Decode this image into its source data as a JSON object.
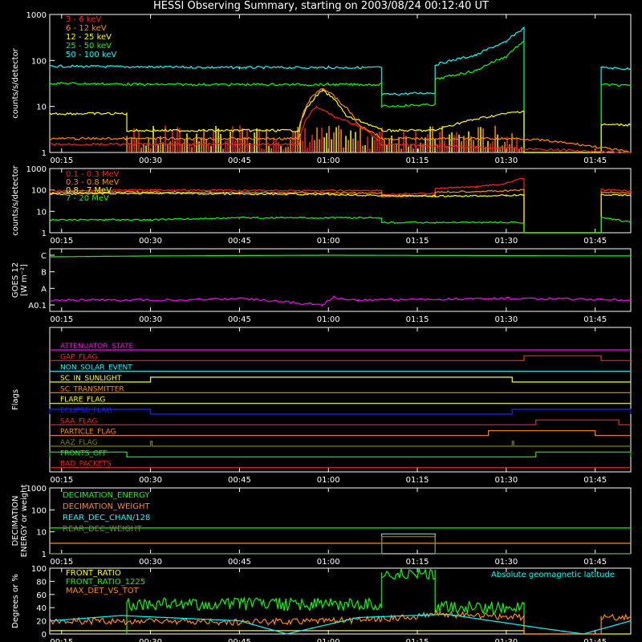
{
  "title": "HESSI Observing Summary, starting on 2003/08/24 00:12:40 UT",
  "x_ticks": [
    "00:15",
    "00:30",
    "00:45",
    "01:00",
    "01:15",
    "01:30",
    "01:45"
  ],
  "chart_data": [
    {
      "type": "line",
      "panel": "low_energy_rates",
      "ylabel": "counts/s/detector",
      "ylog": true,
      "ylim": [
        1,
        1000
      ],
      "y_ticks": [
        "1",
        "10",
        "100",
        "1000"
      ],
      "legend": [
        "3 - 6 keV",
        "6 - 12 keV",
        "12 - 25 keV",
        "25 - 50 keV",
        "50 - 100 keV"
      ],
      "legend_placement": "top-left",
      "colors": [
        "#ff2020",
        "#ff8c00",
        "#ffff00",
        "#00ff00",
        "#00ffff"
      ],
      "series": [
        {
          "name": "50 - 100 keV",
          "x": [
            "00:13",
            "00:30",
            "00:45",
            "01:00",
            "01:09",
            "01:09",
            "01:18",
            "01:18",
            "01:25",
            "01:30",
            "01:33",
            "01:33",
            "01:46",
            "01:46",
            "01:51"
          ],
          "y": [
            75,
            72,
            70,
            70,
            70,
            18,
            20,
            80,
            130,
            250,
            500,
            1,
            1,
            70,
            65
          ]
        },
        {
          "name": "25 - 50 keV",
          "x": [
            "00:13",
            "00:30",
            "00:45",
            "01:00",
            "01:09",
            "01:09",
            "01:18",
            "01:18",
            "01:25",
            "01:30",
            "01:33",
            "01:33",
            "01:46",
            "01:46",
            "01:51"
          ],
          "y": [
            32,
            30,
            30,
            30,
            30,
            10,
            11,
            38,
            60,
            120,
            250,
            1,
            1,
            30,
            28
          ]
        },
        {
          "name": "12 - 25 keV",
          "x": [
            "00:13",
            "00:26",
            "00:26",
            "00:55",
            "00:57",
            "00:59",
            "01:03",
            "01:09",
            "01:18",
            "01:33",
            "01:33",
            "01:46",
            "01:46",
            "01:51"
          ],
          "y": [
            7,
            7,
            3,
            3,
            12,
            22,
            6,
            3,
            3,
            8,
            1,
            1,
            4,
            4
          ]
        },
        {
          "name": "6 - 12 keV",
          "x": [
            "00:13",
            "00:26",
            "00:55",
            "00:57",
            "00:59",
            "01:02",
            "01:05",
            "01:09",
            "01:33",
            "01:51"
          ],
          "y": [
            2,
            2,
            2,
            15,
            25,
            12,
            4,
            2,
            2,
            1
          ]
        },
        {
          "name": "3 - 6 keV",
          "x": [
            "00:13",
            "00:55",
            "00:58",
            "01:01",
            "01:09",
            "01:33",
            "01:51"
          ],
          "y": [
            1.5,
            1.5,
            10,
            6,
            1.5,
            1.2,
            1
          ]
        }
      ]
    },
    {
      "type": "line",
      "panel": "high_energy_rates",
      "ylabel": "counts/s/detector",
      "ylog": true,
      "ylim": [
        1,
        1000
      ],
      "y_ticks": [
        "1",
        "10",
        "100",
        "1000"
      ],
      "legend": [
        "0.1 - 0.3 MeV",
        "0.3 - 0.8 MeV",
        "0.8 - 7 MeV",
        "7 - 20 MeV"
      ],
      "legend_placement": "top-left",
      "colors": [
        "#ff2020",
        "#ff8c00",
        "#ffff00",
        "#00ff00"
      ],
      "series": [
        {
          "name": "0.1 - 0.3 MeV",
          "x": [
            "00:13",
            "00:30",
            "00:45",
            "01:00",
            "01:09",
            "01:09",
            "01:18",
            "01:18",
            "01:25",
            "01:30",
            "01:33",
            "01:33",
            "01:46",
            "01:46",
            "01:51"
          ],
          "y": [
            90,
            100,
            95,
            92,
            95,
            60,
            70,
            120,
            140,
            200,
            350,
            1,
            1,
            100,
            90
          ]
        },
        {
          "name": "0.3 - 0.8 MeV",
          "x": [
            "00:13",
            "00:30",
            "00:45",
            "01:00",
            "01:09",
            "01:09",
            "01:18",
            "01:18",
            "01:30",
            "01:33",
            "01:33",
            "01:46",
            "01:46",
            "01:51"
          ],
          "y": [
            75,
            80,
            75,
            72,
            72,
            50,
            55,
            80,
            90,
            100,
            1,
            1,
            80,
            70
          ]
        },
        {
          "name": "0.8 - 7 MeV",
          "x": [
            "00:13",
            "00:30",
            "00:45",
            "01:00",
            "01:09",
            "01:18",
            "01:30",
            "01:33",
            "01:33",
            "01:46",
            "01:46",
            "01:51"
          ],
          "y": [
            65,
            70,
            65,
            62,
            55,
            50,
            55,
            60,
            1,
            1,
            60,
            55
          ]
        },
        {
          "name": "7 - 20 MeV",
          "x": [
            "00:13",
            "00:30",
            "00:45",
            "01:00",
            "01:09",
            "01:09",
            "01:18",
            "01:30",
            "01:33",
            "01:33",
            "01:46",
            "01:46",
            "01:51"
          ],
          "y": [
            4,
            4,
            5,
            5,
            5,
            3,
            3,
            3,
            3,
            1,
            1,
            5,
            3
          ]
        }
      ]
    },
    {
      "type": "line",
      "panel": "goes",
      "ylabel": "GOES 12 [W m^-2]",
      "ylog": true,
      "y_ticks": [
        "A0.1",
        "A",
        "B",
        "C"
      ],
      "colors": [
        "#00ff00",
        "#ff00ff"
      ],
      "series": [
        {
          "x": [
            "00:13",
            "00:30",
            "01:00",
            "01:51"
          ],
          "y": [
            "B8",
            "B9",
            "C1",
            "B9"
          ]
        },
        {
          "x": [
            "00:13",
            "00:38",
            "00:45",
            "00:59",
            "01:01",
            "01:03",
            "01:05",
            "01:30",
            "01:51"
          ],
          "y": [
            "A0.2",
            "A0.2",
            "A0.25",
            "A0.1",
            "A0.3",
            "A0.2",
            "A0.2",
            "A0.25",
            "A0.2"
          ]
        }
      ]
    },
    {
      "type": "line",
      "panel": "flags",
      "ylabel": "Flags",
      "flags": [
        {
          "name": "ATTENUATOR_STATE",
          "color": "#ff00ff",
          "on": []
        },
        {
          "name": "GAP_FLAG",
          "color": "#ff2020",
          "on": [
            [
              "01:33",
              "01:46"
            ]
          ]
        },
        {
          "name": "NON_SOLAR_EVENT",
          "color": "#00ffff",
          "on": []
        },
        {
          "name": "SC_IN_SUNLIGHT",
          "color": "#ffff00",
          "on": [
            [
              "00:30",
              "01:31"
            ]
          ]
        },
        {
          "name": "SC_TRANSMITTER",
          "color": "#ff8c00",
          "on": []
        },
        {
          "name": "FLARE_FLAG",
          "color": "#ffff00",
          "on": []
        },
        {
          "name": "ECLIPSE_FLAG",
          "color": "#2020ff",
          "on": [
            [
              "00:13",
              "00:30"
            ],
            [
              "01:31",
              "01:51"
            ]
          ]
        },
        {
          "name": "SAA_FLAG",
          "color": "#ff2020",
          "on": [
            [
              "01:35",
              "01:49"
            ]
          ]
        },
        {
          "name": "PARTICLE_FLAG",
          "color": "#ff8c00",
          "on": [
            [
              "01:27",
              "01:45"
            ]
          ]
        },
        {
          "name": "AAZ_FLAG",
          "color": "#808000",
          "on": [
            [
              "00:30",
              "00:30"
            ],
            [
              "01:31",
              "01:31"
            ]
          ]
        },
        {
          "name": "FRONTS_OFF",
          "color": "#00ff00",
          "on": [
            [
              "00:13",
              "00:26"
            ],
            [
              "01:35",
              "01:51"
            ]
          ]
        },
        {
          "name": "BAD_PACKETS",
          "color": "#ff2020",
          "on": []
        }
      ]
    },
    {
      "type": "line",
      "panel": "decimation",
      "ylabel": "DECIMATION ENERGY or weight",
      "ylog": true,
      "ylim": [
        1,
        1000
      ],
      "y_ticks": [
        "1",
        "10",
        "100",
        "1000"
      ],
      "legend": [
        "DECIMATION_ENERGY",
        "DECIMATION_WEIGHT",
        "REAR_DEC_CHAN/128",
        "REAR_DEC_WEIGHT"
      ],
      "legend_placement": "top-left",
      "colors": [
        "#00ff00",
        "#ff8c00",
        "#00ffff",
        "#808040"
      ],
      "series": [
        {
          "name": "DECIMATION_ENERGY",
          "x": [
            "00:13",
            "01:51"
          ],
          "y": [
            15,
            15
          ]
        },
        {
          "name": "DECIMATION_WEIGHT",
          "x": [
            "00:13",
            "01:51"
          ],
          "y": [
            3,
            3
          ]
        },
        {
          "name": "REAR_DEC_CHAN/128",
          "x": [
            "00:13",
            "01:09",
            "01:09",
            "01:18",
            "01:18",
            "01:51"
          ],
          "y": [
            1,
            1,
            8,
            8,
            1,
            1
          ]
        },
        {
          "name": "REAR_DEC_WEIGHT",
          "x": [
            "00:13",
            "01:09",
            "01:09",
            "01:18",
            "01:18",
            "01:51"
          ],
          "y": [
            1,
            1,
            6,
            6,
            1,
            1
          ]
        }
      ]
    },
    {
      "type": "line",
      "panel": "ratios",
      "ylabel": "Degrees or %",
      "ylim": [
        0,
        100
      ],
      "y_ticks": [
        "0",
        "20",
        "40",
        "60",
        "80",
        "100"
      ],
      "legend": [
        "FRONT_RATIO",
        "FRONT_RATIO_1225",
        "MAX_DET_VS_TOT"
      ],
      "legend_placement": "top-left",
      "annotation": "Absolute geomagnetic latitude",
      "colors": [
        "#ffff00",
        "#00ff00",
        "#ff8c00",
        "#00ffff"
      ],
      "series": [
        {
          "name": "FRONT_RATIO",
          "x": [
            "00:13",
            "01:33",
            "01:33",
            "01:51"
          ],
          "y": [
            5,
            5,
            0,
            0
          ]
        },
        {
          "name": "FRONT_RATIO_1225",
          "x": [
            "00:26",
            "00:26",
            "00:45",
            "01:09",
            "01:09",
            "01:18",
            "01:18",
            "01:33",
            "01:33"
          ],
          "y": [
            0,
            45,
            45,
            45,
            90,
            90,
            40,
            40,
            0
          ]
        },
        {
          "name": "MAX_DET_VS_TOT",
          "x": [
            "00:13",
            "00:45",
            "01:09",
            "01:18",
            "01:33",
            "01:33",
            "01:46",
            "01:46",
            "01:51"
          ],
          "y": [
            20,
            18,
            22,
            30,
            25,
            0,
            0,
            25,
            25
          ]
        },
        {
          "name": "Absolute geomagnetic latitude",
          "x": [
            "00:13",
            "00:25",
            "00:45",
            "00:53",
            "01:05",
            "01:20",
            "01:35",
            "01:43",
            "01:51"
          ],
          "y": [
            20,
            28,
            20,
            0,
            25,
            30,
            10,
            0,
            20
          ]
        }
      ]
    }
  ]
}
